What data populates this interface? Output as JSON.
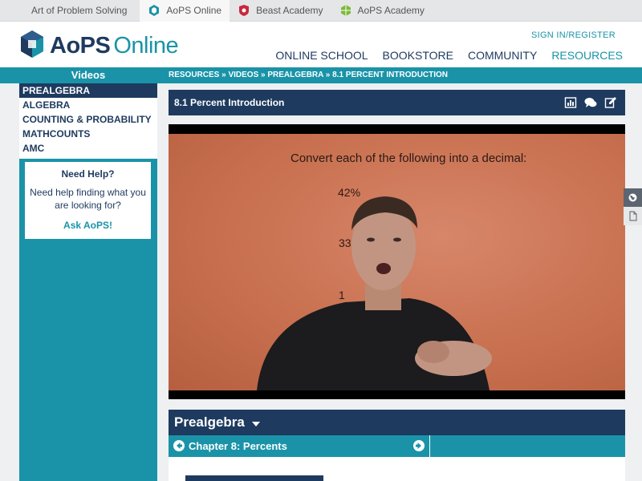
{
  "top_tabs": [
    {
      "label": "Art of Problem Solving",
      "icon": "none"
    },
    {
      "label": "AoPS Online",
      "icon": "aops-cube-icon",
      "active": true
    },
    {
      "label": "Beast Academy",
      "icon": "beast-academy-shield-icon"
    },
    {
      "label": "AoPS Academy",
      "icon": "aops-academy-cube-icon"
    }
  ],
  "header": {
    "logo_main": "AoPS",
    "logo_sub": "Online",
    "signin": "SIGN IN/REGISTER",
    "nav": [
      "ONLINE SCHOOL",
      "BOOKSTORE",
      "COMMUNITY",
      "RESOURCES"
    ],
    "active_nav": "RESOURCES"
  },
  "band": {
    "title": "Videos",
    "breadcrumb": "RESOURCES » VIDEOS » PREALGEBRA » 8.1 PERCENT INTRODUCTION"
  },
  "sidebar": {
    "items": [
      "PREALGEBRA",
      "ALGEBRA",
      "COUNTING & PROBABILITY",
      "MATHCOUNTS",
      "AMC"
    ],
    "active": "PREALGEBRA",
    "help": {
      "heading": "Need Help?",
      "text": "Need help finding what you are looking for?",
      "link": "Ask AoPS!"
    }
  },
  "video": {
    "title": "8.1 Percent Introduction",
    "tools": [
      "bar-chart-icon",
      "comments-icon",
      "edit-icon"
    ],
    "slide_question": "Convert each of the following into a decimal:",
    "slide_item_1": "42%",
    "slide_item_2": "33",
    "slide_item_3": "1"
  },
  "course": {
    "title": "Prealgebra",
    "chapter": "Chapter 8: Percents"
  },
  "colors": {
    "navy": "#1e3a5f",
    "teal": "#1a93a8",
    "top_strip": "#e4e6e8",
    "background": "#eef0f2"
  }
}
